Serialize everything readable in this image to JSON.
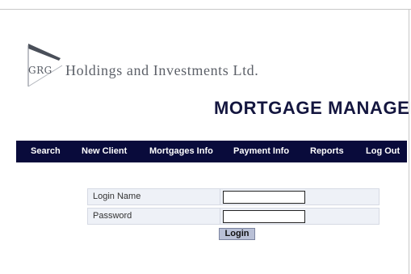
{
  "header": {
    "logo_text": "GRG",
    "company_name": "Holdings and Investments Ltd.",
    "app_title": "MORTGAGE MANAGER"
  },
  "nav": {
    "items": [
      {
        "label": "Search"
      },
      {
        "label": "New Client"
      },
      {
        "label": "Mortgages Info"
      },
      {
        "label": "Payment Info"
      },
      {
        "label": "Reports"
      },
      {
        "label": "Log Out"
      }
    ]
  },
  "login_form": {
    "login_name_label": "Login Name",
    "login_name_value": "",
    "password_label": "Password",
    "password_value": "",
    "submit_label": "Login"
  },
  "colors": {
    "nav_background": "#090b3b",
    "title": "#14163f",
    "form_cell": "#eef1f7",
    "button": "#b9c0d6"
  }
}
